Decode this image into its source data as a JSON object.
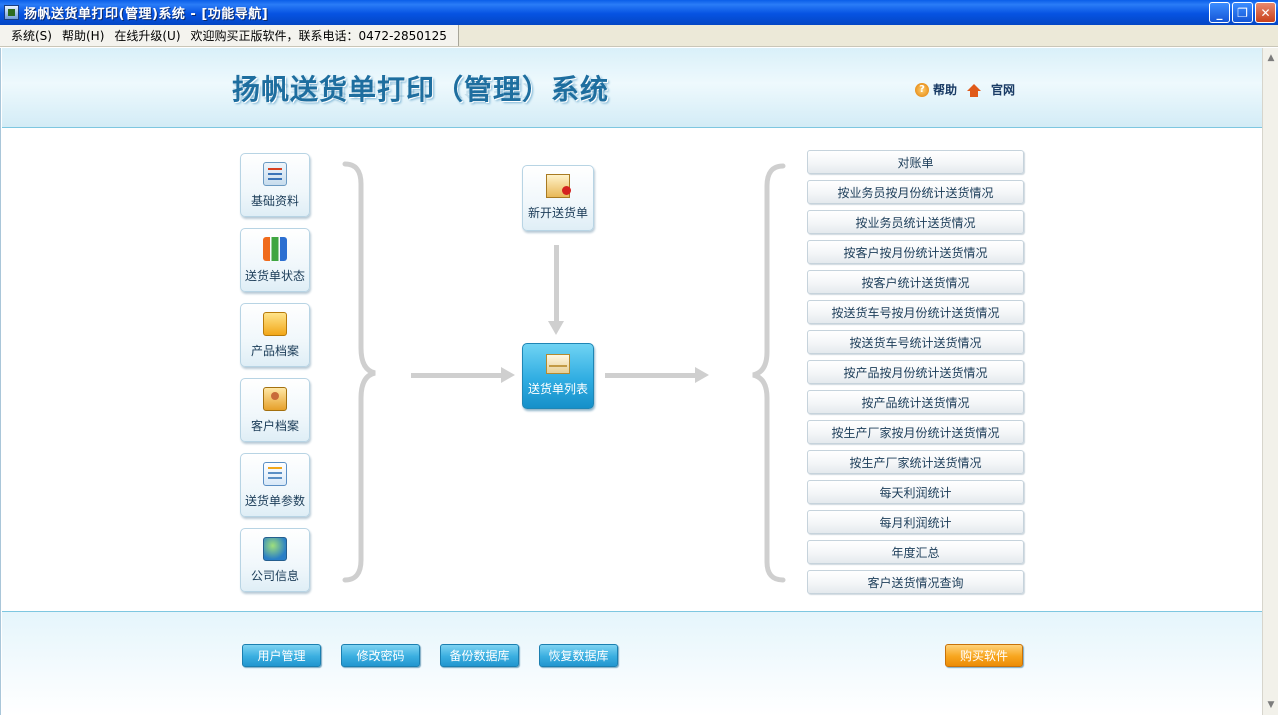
{
  "window": {
    "title": "扬帆送货单打印(管理)系统 - [功能导航]",
    "buttons": {
      "minimize": "_",
      "restore": "❐",
      "close": "✕"
    }
  },
  "menu": {
    "items": [
      "系统(S)",
      "帮助(H)",
      "在线升级(U)",
      "欢迎购买正版软件，联系电话：0472-2850125"
    ]
  },
  "header": {
    "logo_title": "扬帆送货单打印（管理）系统",
    "help_label": "帮助",
    "site_label": "官网"
  },
  "left_tiles": [
    {
      "label": "基础资料",
      "icon": "basic-data-icon"
    },
    {
      "label": "送货单状态",
      "icon": "bar-chart-icon"
    },
    {
      "label": "产品档案",
      "icon": "product-folder-icon"
    },
    {
      "label": "客户档案",
      "icon": "customer-icon"
    },
    {
      "label": "送货单参数",
      "icon": "notepad-icon"
    },
    {
      "label": "公司信息",
      "icon": "globe-icon"
    }
  ],
  "center": {
    "new_label": "新开送货单",
    "list_label": "送货单列表"
  },
  "reports": [
    "对账单",
    "按业务员按月份统计送货情况",
    "按业务员统计送货情况",
    "按客户按月份统计送货情况",
    "按客户统计送货情况",
    "按送货车号按月份统计送货情况",
    "按送货车号统计送货情况",
    "按产品按月份统计送货情况",
    "按产品统计送货情况",
    "按生产厂家按月份统计送货情况",
    "按生产厂家统计送货情况",
    "每天利润统计",
    "每月利润统计",
    "年度汇总",
    "客户送货情况查询"
  ],
  "footer": {
    "user_mgmt": "用户管理",
    "change_pwd": "修改密码",
    "backup_db": "备份数据库",
    "restore_db": "恢复数据库",
    "buy": "购买软件"
  },
  "colors": {
    "titlebar": "#0653e2",
    "header_bg": "#d9f0f9",
    "accent_blue": "#30ade2",
    "buy_orange": "#f7a51e"
  }
}
